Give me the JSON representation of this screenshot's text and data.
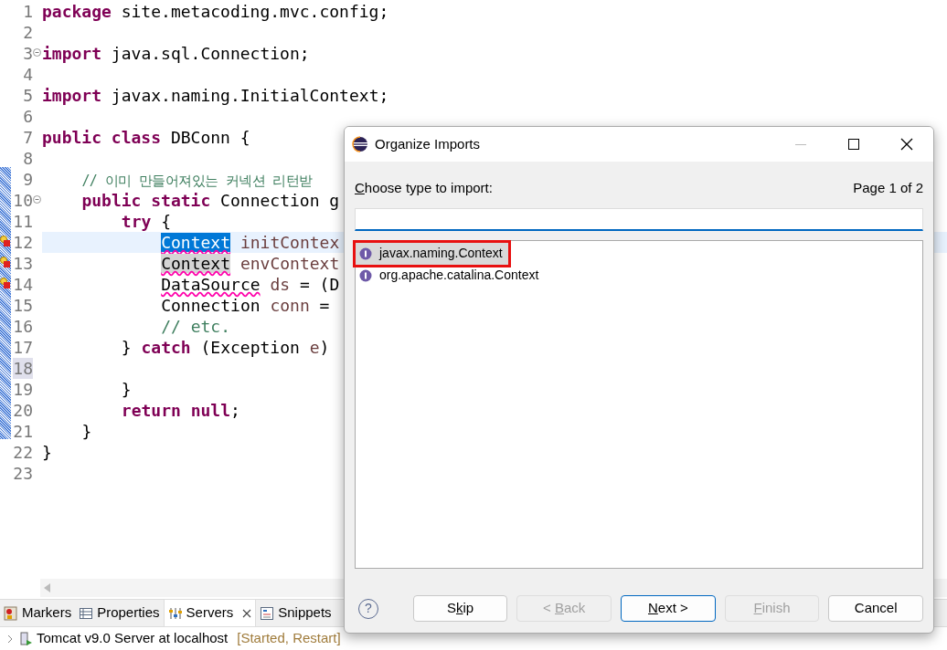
{
  "editor": {
    "lines": [
      {
        "number": "1",
        "segments": [
          {
            "text": "package",
            "kind": "keyword"
          },
          {
            "text": " site.metacoding.mvc.config;",
            "kind": "plain"
          }
        ]
      },
      {
        "number": "2"
      },
      {
        "number": "3",
        "fold": true,
        "segments": [
          {
            "text": "import",
            "kind": "keyword"
          },
          {
            "text": " java.sql.Connection;",
            "kind": "plain"
          }
        ]
      },
      {
        "number": "4"
      },
      {
        "number": "5",
        "segments": [
          {
            "text": "import",
            "kind": "keyword"
          },
          {
            "text": " javax.naming.InitialContext;",
            "kind": "plain"
          }
        ]
      },
      {
        "number": "6"
      },
      {
        "number": "7",
        "segments": [
          {
            "text": "public class",
            "kind": "keyword"
          },
          {
            "text": " DBConn {",
            "kind": "plain"
          }
        ],
        "children": [
          {
            "number": "8"
          },
          {
            "number": "9",
            "segments": [
              {
                "text": "// 이미 만들어져있는 커넥션 리턴받",
                "kind": "comment_hangul"
              }
            ]
          },
          {
            "number": "10",
            "fold": true,
            "segments": [
              {
                "text": "public static",
                "kind": "keyword"
              },
              {
                "text": " Connection g",
                "kind": "plain"
              }
            ],
            "children": [
              {
                "number": "11",
                "segments": [
                  {
                    "text": "try",
                    "kind": "keyword"
                  },
                  {
                    "text": " {",
                    "kind": "plain"
                  }
                ],
                "children": [
                  {
                    "number": "12",
                    "current": true,
                    "marker": true,
                    "segments": [
                      {
                        "text": "Context",
                        "kind": "selected"
                      },
                      {
                        "text": " initContex",
                        "kind": "variable"
                      }
                    ]
                  },
                  {
                    "number": "13",
                    "marker": true,
                    "segments": [
                      {
                        "text": "Context",
                        "kind": "occurrence"
                      },
                      {
                        "text": " envContext",
                        "kind": "variable"
                      }
                    ]
                  },
                  {
                    "number": "14",
                    "marker": true,
                    "segments": [
                      {
                        "text": "DataSource",
                        "kind": "error"
                      },
                      {
                        "text": " ds",
                        "kind": "variable"
                      },
                      {
                        "text": " = (D",
                        "kind": "plain"
                      }
                    ]
                  },
                  {
                    "number": "15",
                    "segments": [
                      {
                        "text": "Connection",
                        "kind": "plain"
                      },
                      {
                        "text": " conn",
                        "kind": "variable"
                      },
                      {
                        "text": " =",
                        "kind": "plain"
                      }
                    ]
                  },
                  {
                    "number": "16",
                    "segments": [
                      {
                        "text": "// etc.",
                        "kind": "comment"
                      }
                    ]
                  }
                ]
              },
              {
                "number": "17",
                "segments": [
                  {
                    "text": "} ",
                    "kind": "plain"
                  },
                  {
                    "text": "catch",
                    "kind": "keyword"
                  },
                  {
                    "text": " (Exception",
                    "kind": "plain"
                  },
                  {
                    "text": " e",
                    "kind": "variable"
                  },
                  {
                    "text": ")",
                    "kind": "plain"
                  }
                ],
                "children": [
                  {
                    "number": "18",
                    "caret_line": true
                  }
                ]
              },
              {
                "number": "19",
                "segments": [
                  {
                    "text": "}",
                    "kind": "plain"
                  }
                ]
              },
              {
                "number": "20",
                "segments": [
                  {
                    "text": "return null",
                    "kind": "keyword"
                  },
                  {
                    "text": ";",
                    "kind": "plain"
                  }
                ]
              }
            ]
          },
          {
            "number": "21",
            "segments": [
              {
                "text": "}",
                "kind": "plain"
              }
            ]
          }
        ]
      },
      {
        "number": "22",
        "segments": [
          {
            "text": "}",
            "kind": "plain"
          }
        ]
      },
      {
        "number": "23"
      }
    ]
  },
  "bottom_panel": {
    "tabs": [
      {
        "label": "Markers",
        "selected": false
      },
      {
        "label": "Properties",
        "selected": false
      },
      {
        "label": "Servers",
        "selected": true,
        "closable": true
      },
      {
        "label": "Snippets",
        "selected": false
      }
    ],
    "servers": [
      {
        "name": "Tomcat v9.0 Server at localhost",
        "status": "[Started, Restart]"
      }
    ]
  },
  "dialog": {
    "title": "Organize Imports",
    "prompt": {
      "mnemonic": "C",
      "after": "hoose type to import:"
    },
    "page": "Page 1 of 2",
    "types": [
      {
        "name": "javax.naming.Context",
        "selected": true
      },
      {
        "name": "org.apache.catalina.Context",
        "selected": false
      }
    ],
    "help": "?",
    "buttons": [
      {
        "before": "S",
        "mnemonic": "k",
        "after": "ip",
        "disabled": false,
        "default": false
      },
      {
        "before": "< ",
        "mnemonic": "B",
        "after": "ack",
        "disabled": true,
        "default": false
      },
      {
        "mnemonic": "N",
        "after": "ext >",
        "disabled": false,
        "default": true
      },
      {
        "mnemonic": "F",
        "after": "inish",
        "disabled": true,
        "default": false
      },
      {
        "before": "Cancel",
        "disabled": false,
        "default": false
      }
    ]
  }
}
